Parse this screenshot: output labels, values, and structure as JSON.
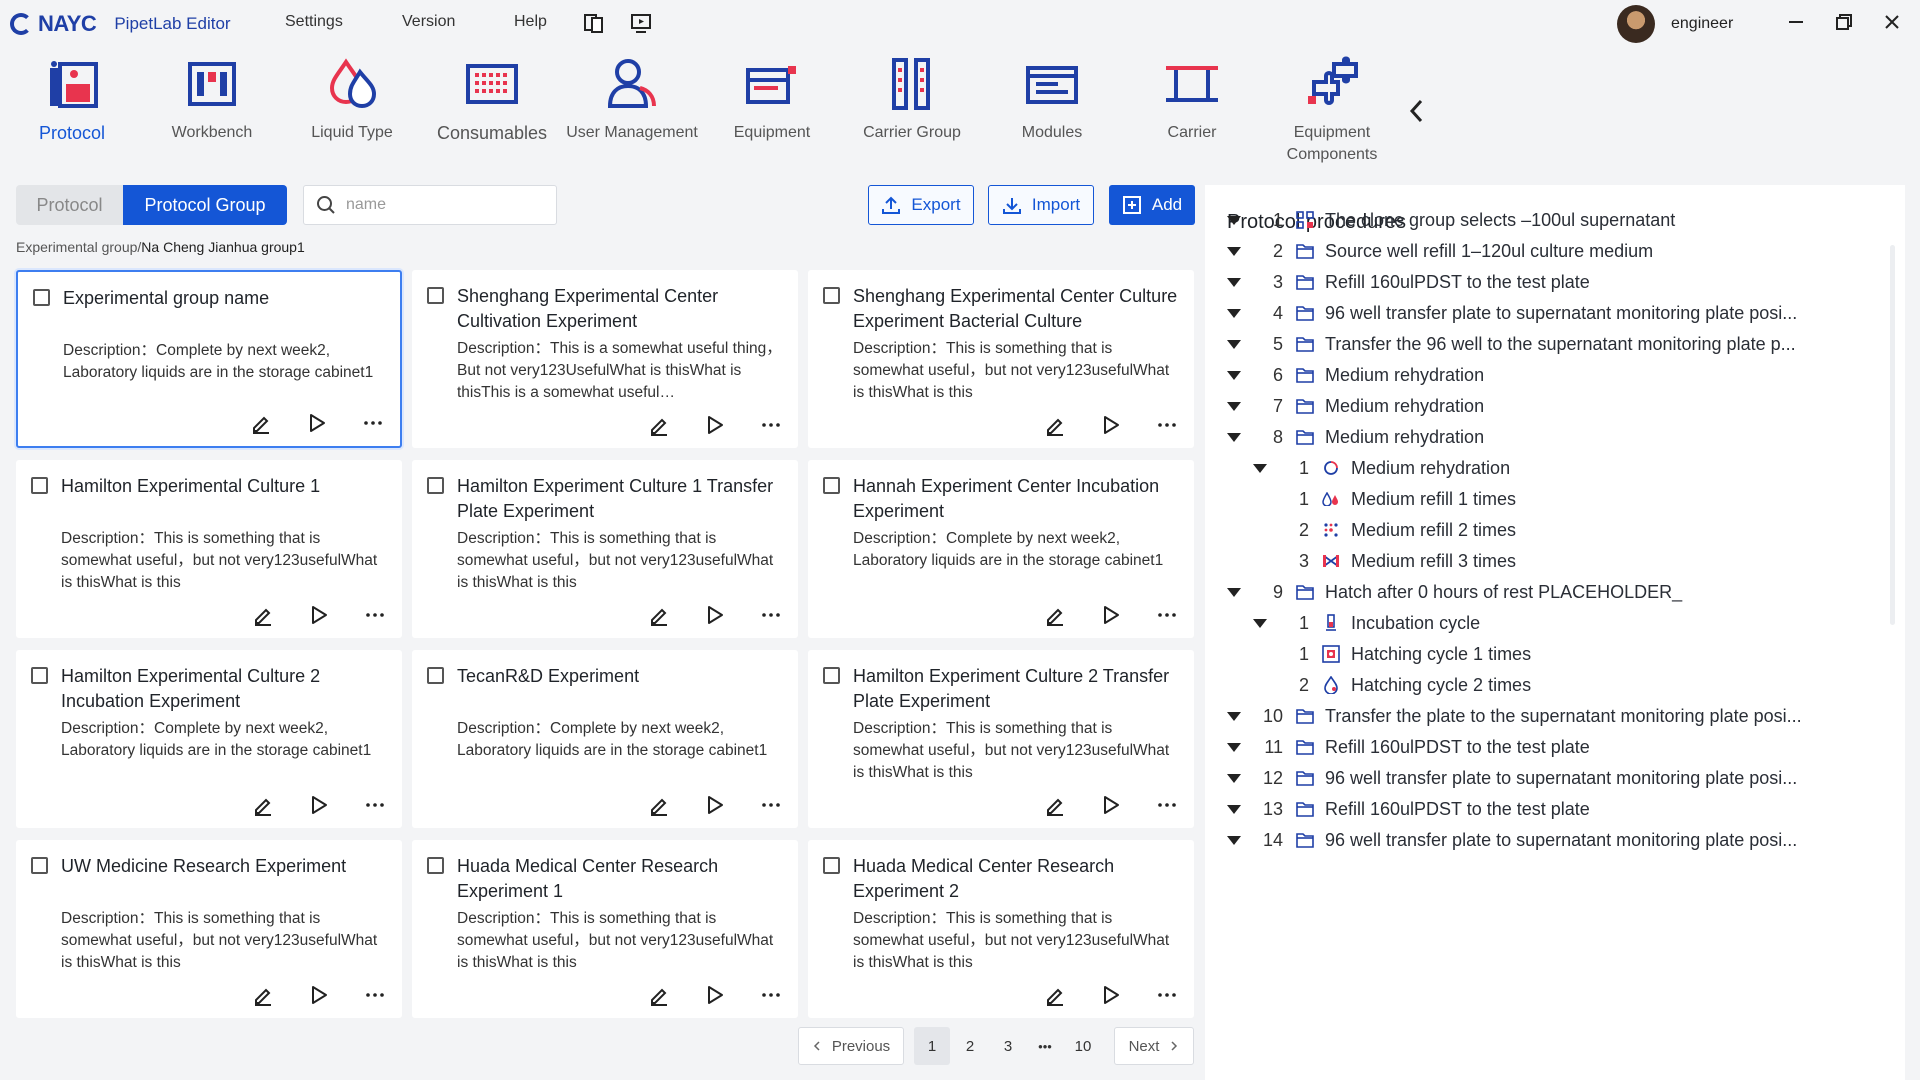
{
  "app": {
    "brand": "NAYC",
    "name": "PipetLab Editor",
    "menus": [
      "Settings",
      "Version",
      "Help"
    ],
    "user": "engineer"
  },
  "nav": [
    {
      "label": "Protocol",
      "icon": "protocol-icon",
      "active": true
    },
    {
      "label": "Workbench",
      "icon": "workbench-icon"
    },
    {
      "label": "Liquid Type",
      "icon": "liquid-drop-icon"
    },
    {
      "label": "Consumables",
      "icon": "plate-grid-icon"
    },
    {
      "label": "User Management",
      "icon": "user-icon"
    },
    {
      "label": "Equipment",
      "icon": "equipment-icon"
    },
    {
      "label": "Carrier Group",
      "icon": "carrier-group-icon"
    },
    {
      "label": "Modules",
      "icon": "modules-icon"
    },
    {
      "label": "Carrier",
      "icon": "carrier-icon"
    },
    {
      "label": "Equipment Components",
      "icon": "puzzle-icon"
    }
  ],
  "toolbar": {
    "tab_protocol": "Protocol",
    "tab_group": "Protocol Group",
    "search_placeholder": "name",
    "export": "Export",
    "import": "Import",
    "add": "Add"
  },
  "breadcrumb": {
    "parent": "Experimental group/",
    "current": "Na Cheng Jianhua group1"
  },
  "cards": [
    {
      "title": "Experimental group name",
      "desc": "Description：Complete by next week2, Laboratory liquids are in the storage cabinet1"
    },
    {
      "title": "Shenghang Experimental Center Cultivation Experiment",
      "desc": "Description：This is a somewhat useful thing，But not very123UsefulWhat is thisWhat is thisThis is a somewhat useful…"
    },
    {
      "title": "Shenghang Experimental Center Culture Experiment Bacterial Culture",
      "desc": "Description：This is something that is somewhat useful，but not very123usefulWhat is thisWhat is this"
    },
    {
      "title": "Hamilton Experimental Culture 1",
      "desc": "Description：This is something that is somewhat useful，but not very123usefulWhat is thisWhat is this"
    },
    {
      "title": "Hamilton Experiment Culture 1 Transfer Plate Experiment",
      "desc": "Description：This is something that is somewhat useful，but not very123usefulWhat is thisWhat is this"
    },
    {
      "title": "Hannah Experiment Center Incubation Experiment",
      "desc": "Description：Complete by next week2, Laboratory liquids are in the storage cabinet1"
    },
    {
      "title": "Hamilton Experimental Culture 2 Incubation Experiment",
      "desc": "Description：Complete by next week2, Laboratory liquids are in the storage cabinet1"
    },
    {
      "title": "TecanR&D Experiment",
      "desc": "Description：Complete by next week2, Laboratory liquids are in the storage cabinet1"
    },
    {
      "title": "Hamilton Experiment Culture 2 Transfer Plate Experiment",
      "desc": "Description：This is something that is somewhat useful，but not very123usefulWhat is thisWhat is this"
    },
    {
      "title": "UW Medicine Research Experiment",
      "desc": "Description：This is something that is somewhat useful，but not very123usefulWhat is thisWhat is this"
    },
    {
      "title": "Huada Medical Center Research Experiment 1",
      "desc": "Description：This is something that is somewhat useful，but not very123usefulWhat is thisWhat is this"
    },
    {
      "title": "Huada Medical Center Research Experiment 2",
      "desc": "Description：This is something that is somewhat useful，but not very123usefulWhat is thisWhat is this"
    }
  ],
  "pagination": {
    "prev": "Previous",
    "next": "Next",
    "pages": [
      "1",
      "2",
      "3",
      "•••",
      "10"
    ],
    "current": "1"
  },
  "procedures": {
    "title": "Protocol procedures",
    "items": [
      {
        "num": "1",
        "label": "The clone group selects –100ul supernatant",
        "icon": "clone-grid-icon",
        "level": 0,
        "caret": true
      },
      {
        "num": "2",
        "label": "Source well refill 1–120ul culture medium",
        "icon": "folder-icon",
        "level": 0,
        "caret": true
      },
      {
        "num": "3",
        "label": "Refill 160ulPDST to the test plate",
        "icon": "folder-icon",
        "level": 0,
        "caret": true
      },
      {
        "num": "4",
        "label": "96 well transfer plate to supernatant monitoring plate posi...",
        "icon": "folder-icon",
        "level": 0,
        "caret": true
      },
      {
        "num": "5",
        "label": "Transfer the 96 well to the supernatant monitoring plate p...",
        "icon": "folder-icon",
        "level": 0,
        "caret": true
      },
      {
        "num": "6",
        "label": "Medium rehydration",
        "icon": "folder-icon",
        "level": 0,
        "caret": true
      },
      {
        "num": "7",
        "label": "Medium rehydration",
        "icon": "folder-icon",
        "level": 0,
        "caret": true
      },
      {
        "num": "8",
        "label": "Medium rehydration",
        "icon": "folder-icon",
        "level": 0,
        "caret": true
      },
      {
        "num": "1",
        "label": "Medium rehydration",
        "icon": "cycle-icon",
        "level": 1,
        "caret": true
      },
      {
        "num": "1",
        "label": "Medium refill 1 times",
        "icon": "drops-icon",
        "level": 2,
        "caret": false
      },
      {
        "num": "2",
        "label": "Medium refill 2 times",
        "icon": "dots-icon",
        "level": 2,
        "caret": false
      },
      {
        "num": "3",
        "label": "Medium refill 3 times",
        "icon": "cross-icon",
        "level": 2,
        "caret": false
      },
      {
        "num": "9",
        "label": "Hatch after 0 hours of rest PLACEHOLDER_",
        "icon": "folder-icon",
        "level": 0,
        "caret": true
      },
      {
        "num": "1",
        "label": "Incubation cycle",
        "icon": "tube-icon",
        "level": 1,
        "caret": true
      },
      {
        "num": "1",
        "label": "Hatching cycle 1 times",
        "icon": "incubator-icon",
        "level": 2,
        "caret": false
      },
      {
        "num": "2",
        "label": "Hatching cycle 2 times",
        "icon": "drop-icon",
        "level": 2,
        "caret": false
      },
      {
        "num": "10",
        "label": "Transfer the plate to the supernatant monitoring plate posi...",
        "icon": "folder-icon",
        "level": 0,
        "caret": true
      },
      {
        "num": "11",
        "label": "Refill 160ulPDST to the test plate",
        "icon": "folder-icon",
        "level": 0,
        "caret": true
      },
      {
        "num": "12",
        "label": "96 well transfer plate to supernatant monitoring plate posi...",
        "icon": "folder-icon",
        "level": 0,
        "caret": true
      },
      {
        "num": "13",
        "label": "Refill 160ulPDST to the test plate",
        "icon": "folder-icon",
        "level": 0,
        "caret": true
      },
      {
        "num": "14",
        "label": "96 well transfer plate to supernatant monitoring plate posi...",
        "icon": "folder-icon",
        "level": 0,
        "caret": true
      }
    ]
  },
  "colors": {
    "primary": "#1456d6",
    "accent_red": "#e8344e",
    "navy": "#1f3fa6"
  }
}
